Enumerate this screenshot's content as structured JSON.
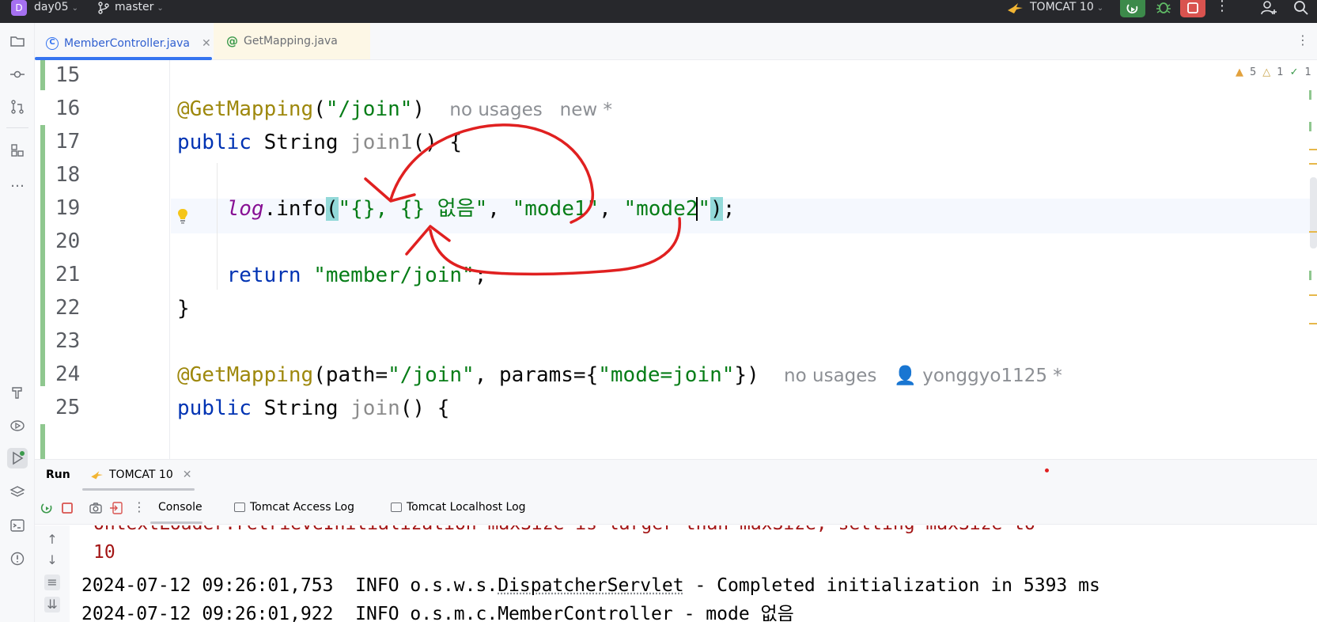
{
  "titlebar": {
    "project_badge": "D",
    "project_name": "day05",
    "branch": "master",
    "run_config": "TOMCAT 10"
  },
  "editor_tabs": [
    {
      "label": "MemberController.java",
      "active": true,
      "icon": "class-icon"
    },
    {
      "label": "GetMapping.java",
      "active": false,
      "icon": "annotation-icon"
    }
  ],
  "inspections": {
    "warnings": "5",
    "weak_warnings": "1",
    "typos": "1"
  },
  "code": {
    "lines": [
      {
        "number": "15"
      },
      {
        "number": "16",
        "annotation": "@GetMapping",
        "args": "(\"/join\")",
        "hint": "no usages   new *"
      },
      {
        "number": "17",
        "kw": "public",
        "type": "String",
        "method": "join1",
        "rest": "() {"
      },
      {
        "number": "18"
      },
      {
        "number": "19",
        "field": "log",
        "call": ".info",
        "open": "(",
        "fmt": "\"{}, {} 없음\"",
        "comma1": ", ",
        "arg1": "\"mode1\"",
        "comma2": ", ",
        "arg2": "\"mode2\"",
        "close": ")",
        "end": ";"
      },
      {
        "number": "20"
      },
      {
        "number": "21",
        "kw": "return",
        "str": "\"member/join\"",
        "end": ";"
      },
      {
        "number": "22",
        "text": "}"
      },
      {
        "number": "23"
      },
      {
        "number": "24",
        "annotation": "@GetMapping",
        "open": "(path=",
        "str1": "\"/join\"",
        "mid": ", params={",
        "str2": "\"mode=join\"",
        "close": "})",
        "hint": "no usages",
        "author": "yonggyo1125 *"
      },
      {
        "number": "25",
        "kw": "public",
        "type": "String",
        "method": "join",
        "rest": "() {"
      }
    ]
  },
  "run_panel": {
    "title": "Run",
    "tab": "TOMCAT 10",
    "console_tabs": [
      "Console",
      "Tomcat Access Log",
      "Tomcat Localhost Log"
    ],
    "output": {
      "partial_top": "ontextLoader.retrieveInitialization maxSize is larger than maxSize; setting maxSize to",
      "line_10": "10",
      "log1_prefix": "2024-07-12 09:26:01,753  INFO o.s.w.s.",
      "log1_link": "DispatcherServlet",
      "log1_suffix": " - Completed initialization in 5393 ms",
      "log2": "2024-07-12 09:26:01,922  INFO o.s.m.c.MemberController - mode 없음"
    }
  },
  "colors": {
    "keyword": "#0033b3",
    "annotation": "#9e880d",
    "string": "#067d17",
    "field": "#871094",
    "accent": "#3574f0",
    "annotation_stroke": "#e02020"
  }
}
